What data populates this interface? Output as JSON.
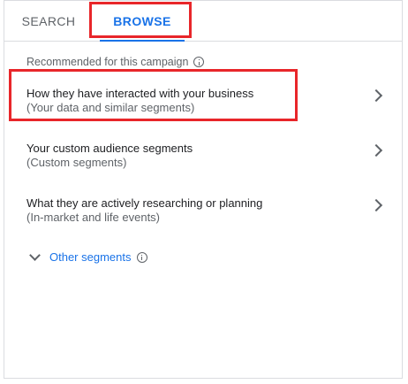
{
  "tabs": {
    "search": "SEARCH",
    "browse": "BROWSE",
    "active": "BROWSE"
  },
  "recommended": {
    "label": "Recommended for this campaign"
  },
  "segments": [
    {
      "title": "How they have interacted with your business",
      "subtitle": "(Your data and similar segments)"
    },
    {
      "title": "Your custom audience segments",
      "subtitle": "(Custom segments)"
    },
    {
      "title": "What they are actively researching or planning",
      "subtitle": "(In-market and life events)"
    }
  ],
  "other_segments": {
    "label": "Other segments"
  },
  "icons": {
    "info": "info-icon",
    "chevron_right": "chevron-right-icon",
    "chevron_down": "chevron-down-icon"
  },
  "colors": {
    "accent": "#1a73e8",
    "highlight": "#e8262a",
    "text_secondary": "#5f6368"
  }
}
